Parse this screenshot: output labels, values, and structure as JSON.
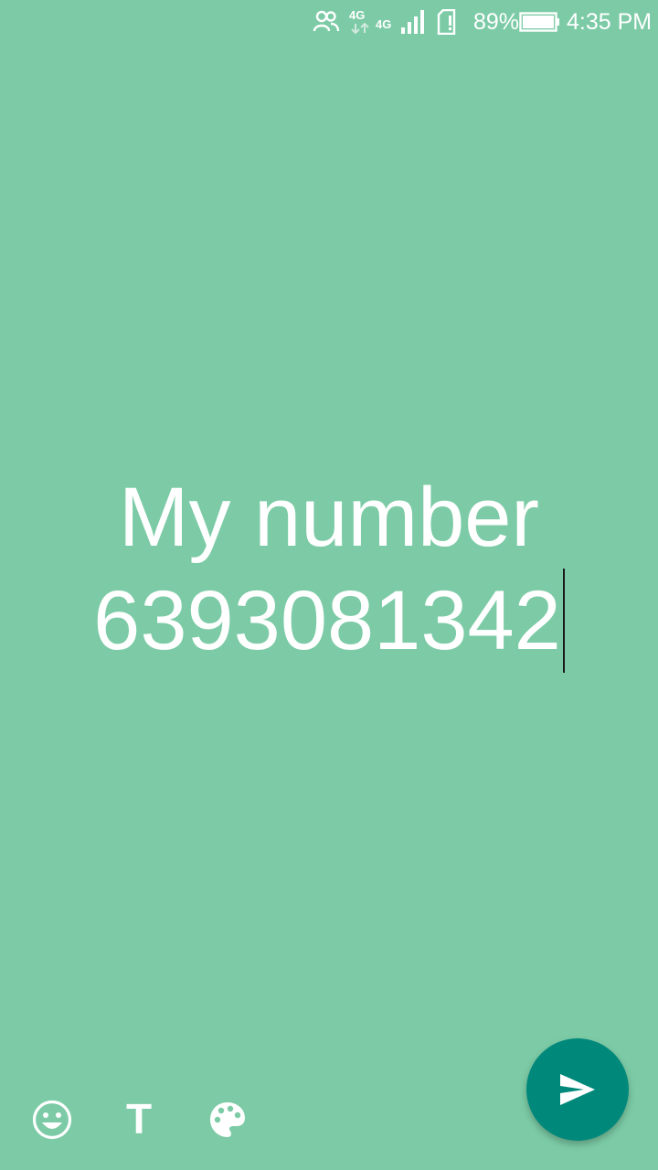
{
  "status_bar": {
    "battery_percent_text": "89%",
    "time": "4:35 PM",
    "network_labels": [
      "4G",
      "4G"
    ],
    "icons": [
      "contacts-icon",
      "data-arrows-icon",
      "signal-icon",
      "sim-alert-icon",
      "battery-icon"
    ]
  },
  "editor": {
    "line1": "My number",
    "line2": "6393081342",
    "background_color": "#7ccba6"
  },
  "toolbar": {
    "emoji_icon": "emoji-icon",
    "text_label": "T",
    "palette_icon": "palette-icon"
  },
  "send_button": {
    "icon": "send-icon",
    "color": "#00897b"
  }
}
